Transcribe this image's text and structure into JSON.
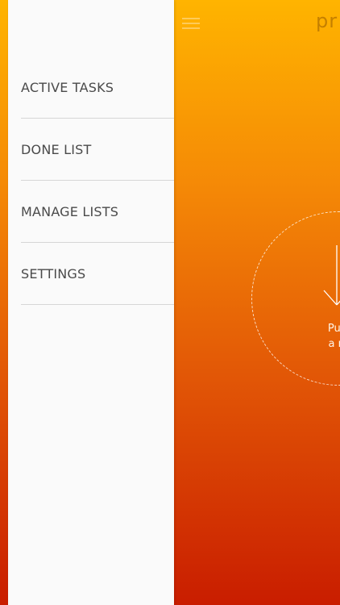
{
  "menu": {
    "items": [
      {
        "label": "ACTIVE TASKS"
      },
      {
        "label": "DONE LIST"
      },
      {
        "label": "MANAGE LISTS"
      },
      {
        "label": "SETTINGS"
      }
    ]
  },
  "header": {
    "logo_text": "pr"
  },
  "main": {
    "pull_text_line1": "Pull to",
    "pull_text_line2": "a new"
  },
  "colors": {
    "gradient_top": "#ffb400",
    "gradient_bottom": "#c91d00",
    "drawer_bg": "#fafafa",
    "menu_text": "#4a4a4a"
  },
  "icons": [
    "hamburger-icon",
    "arrow-down-icon"
  ]
}
